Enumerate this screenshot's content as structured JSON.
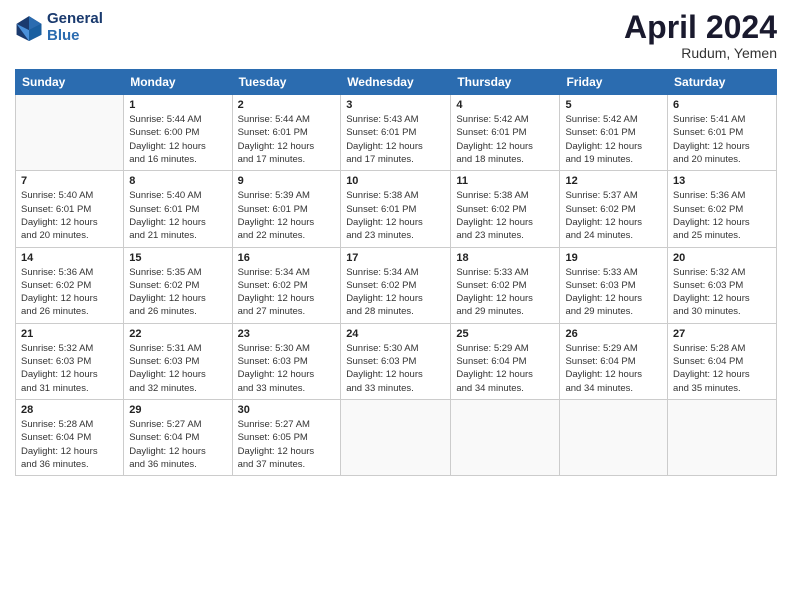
{
  "header": {
    "logo_line1": "General",
    "logo_line2": "Blue",
    "month_title": "April 2024",
    "location": "Rudum, Yemen"
  },
  "days_of_week": [
    "Sunday",
    "Monday",
    "Tuesday",
    "Wednesday",
    "Thursday",
    "Friday",
    "Saturday"
  ],
  "weeks": [
    [
      {
        "num": "",
        "info": ""
      },
      {
        "num": "1",
        "info": "Sunrise: 5:44 AM\nSunset: 6:00 PM\nDaylight: 12 hours\nand 16 minutes."
      },
      {
        "num": "2",
        "info": "Sunrise: 5:44 AM\nSunset: 6:01 PM\nDaylight: 12 hours\nand 17 minutes."
      },
      {
        "num": "3",
        "info": "Sunrise: 5:43 AM\nSunset: 6:01 PM\nDaylight: 12 hours\nand 17 minutes."
      },
      {
        "num": "4",
        "info": "Sunrise: 5:42 AM\nSunset: 6:01 PM\nDaylight: 12 hours\nand 18 minutes."
      },
      {
        "num": "5",
        "info": "Sunrise: 5:42 AM\nSunset: 6:01 PM\nDaylight: 12 hours\nand 19 minutes."
      },
      {
        "num": "6",
        "info": "Sunrise: 5:41 AM\nSunset: 6:01 PM\nDaylight: 12 hours\nand 20 minutes."
      }
    ],
    [
      {
        "num": "7",
        "info": "Sunrise: 5:40 AM\nSunset: 6:01 PM\nDaylight: 12 hours\nand 20 minutes."
      },
      {
        "num": "8",
        "info": "Sunrise: 5:40 AM\nSunset: 6:01 PM\nDaylight: 12 hours\nand 21 minutes."
      },
      {
        "num": "9",
        "info": "Sunrise: 5:39 AM\nSunset: 6:01 PM\nDaylight: 12 hours\nand 22 minutes."
      },
      {
        "num": "10",
        "info": "Sunrise: 5:38 AM\nSunset: 6:01 PM\nDaylight: 12 hours\nand 23 minutes."
      },
      {
        "num": "11",
        "info": "Sunrise: 5:38 AM\nSunset: 6:02 PM\nDaylight: 12 hours\nand 23 minutes."
      },
      {
        "num": "12",
        "info": "Sunrise: 5:37 AM\nSunset: 6:02 PM\nDaylight: 12 hours\nand 24 minutes."
      },
      {
        "num": "13",
        "info": "Sunrise: 5:36 AM\nSunset: 6:02 PM\nDaylight: 12 hours\nand 25 minutes."
      }
    ],
    [
      {
        "num": "14",
        "info": "Sunrise: 5:36 AM\nSunset: 6:02 PM\nDaylight: 12 hours\nand 26 minutes."
      },
      {
        "num": "15",
        "info": "Sunrise: 5:35 AM\nSunset: 6:02 PM\nDaylight: 12 hours\nand 26 minutes."
      },
      {
        "num": "16",
        "info": "Sunrise: 5:34 AM\nSunset: 6:02 PM\nDaylight: 12 hours\nand 27 minutes."
      },
      {
        "num": "17",
        "info": "Sunrise: 5:34 AM\nSunset: 6:02 PM\nDaylight: 12 hours\nand 28 minutes."
      },
      {
        "num": "18",
        "info": "Sunrise: 5:33 AM\nSunset: 6:02 PM\nDaylight: 12 hours\nand 29 minutes."
      },
      {
        "num": "19",
        "info": "Sunrise: 5:33 AM\nSunset: 6:03 PM\nDaylight: 12 hours\nand 29 minutes."
      },
      {
        "num": "20",
        "info": "Sunrise: 5:32 AM\nSunset: 6:03 PM\nDaylight: 12 hours\nand 30 minutes."
      }
    ],
    [
      {
        "num": "21",
        "info": "Sunrise: 5:32 AM\nSunset: 6:03 PM\nDaylight: 12 hours\nand 31 minutes."
      },
      {
        "num": "22",
        "info": "Sunrise: 5:31 AM\nSunset: 6:03 PM\nDaylight: 12 hours\nand 32 minutes."
      },
      {
        "num": "23",
        "info": "Sunrise: 5:30 AM\nSunset: 6:03 PM\nDaylight: 12 hours\nand 33 minutes."
      },
      {
        "num": "24",
        "info": "Sunrise: 5:30 AM\nSunset: 6:03 PM\nDaylight: 12 hours\nand 33 minutes."
      },
      {
        "num": "25",
        "info": "Sunrise: 5:29 AM\nSunset: 6:04 PM\nDaylight: 12 hours\nand 34 minutes."
      },
      {
        "num": "26",
        "info": "Sunrise: 5:29 AM\nSunset: 6:04 PM\nDaylight: 12 hours\nand 34 minutes."
      },
      {
        "num": "27",
        "info": "Sunrise: 5:28 AM\nSunset: 6:04 PM\nDaylight: 12 hours\nand 35 minutes."
      }
    ],
    [
      {
        "num": "28",
        "info": "Sunrise: 5:28 AM\nSunset: 6:04 PM\nDaylight: 12 hours\nand 36 minutes."
      },
      {
        "num": "29",
        "info": "Sunrise: 5:27 AM\nSunset: 6:04 PM\nDaylight: 12 hours\nand 36 minutes."
      },
      {
        "num": "30",
        "info": "Sunrise: 5:27 AM\nSunset: 6:05 PM\nDaylight: 12 hours\nand 37 minutes."
      },
      {
        "num": "",
        "info": ""
      },
      {
        "num": "",
        "info": ""
      },
      {
        "num": "",
        "info": ""
      },
      {
        "num": "",
        "info": ""
      }
    ]
  ]
}
